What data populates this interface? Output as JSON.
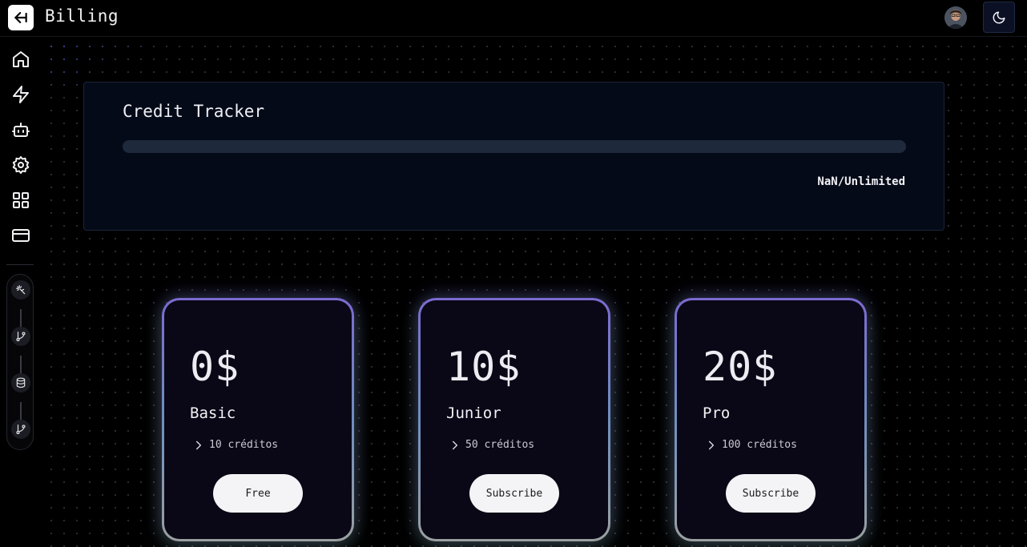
{
  "header": {
    "title": "Billing",
    "back_icon": "arrow-left-icon",
    "theme_icon": "moon-icon"
  },
  "sidebar": {
    "items": [
      {
        "icon": "home-icon"
      },
      {
        "icon": "lightning-icon"
      },
      {
        "icon": "bot-icon"
      },
      {
        "icon": "gear-icon"
      },
      {
        "icon": "grid-icon"
      },
      {
        "icon": "credit-card-icon"
      }
    ],
    "pipeline": [
      {
        "icon": "sparkle-icon"
      },
      {
        "icon": "git-branch-icon"
      },
      {
        "icon": "database-icon"
      },
      {
        "icon": "git-branch-icon"
      }
    ]
  },
  "credit_tracker": {
    "title": "Credit Tracker",
    "count_text": "NaN/Unlimited",
    "progress_fraction": 0
  },
  "plans": [
    {
      "price": "0$",
      "name": "Basic",
      "feature": "10 créditos",
      "button": "Free"
    },
    {
      "price": "10$",
      "name": "Junior",
      "feature": "50 créditos",
      "button": "Subscribe"
    },
    {
      "price": "20$",
      "name": "Pro",
      "feature": "100 créditos",
      "button": "Subscribe"
    }
  ],
  "colors": {
    "background": "#000000",
    "card": "#050a18",
    "progress_track": "#1e293b",
    "plan_border_top": "#7b6ad0",
    "plan_border_bottom": "#9aa0a0"
  }
}
